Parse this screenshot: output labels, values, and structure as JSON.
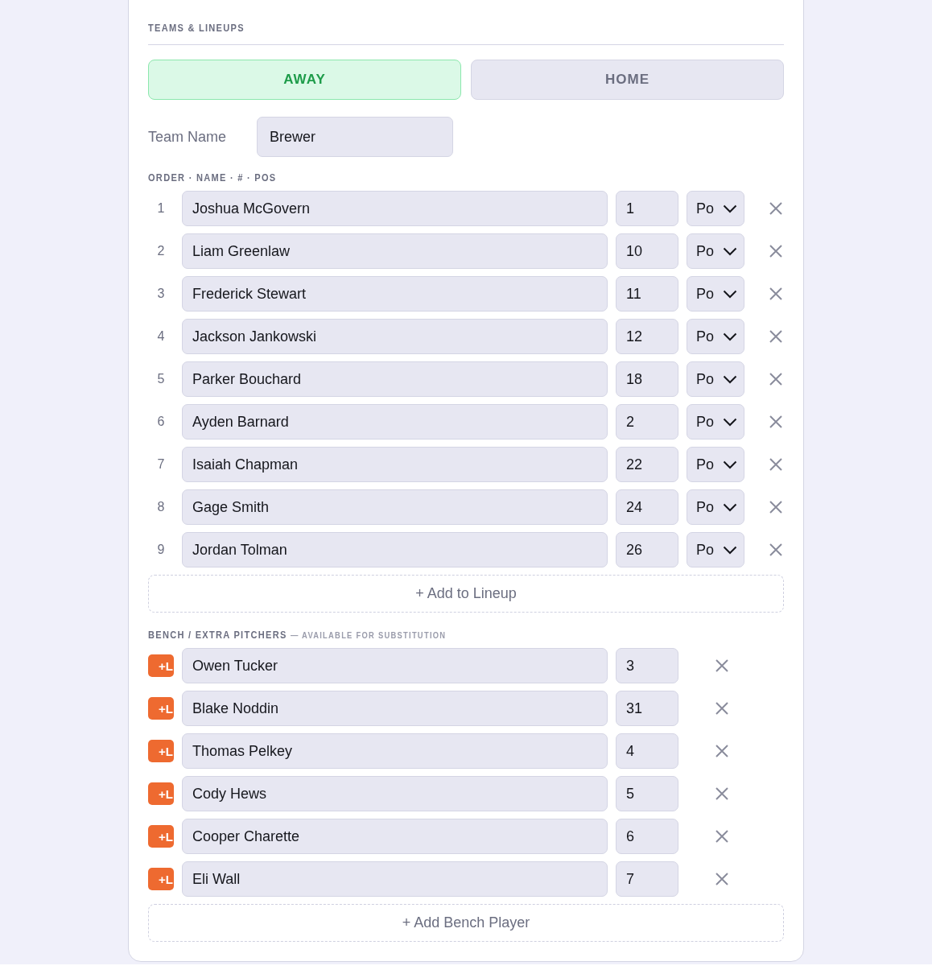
{
  "section_title": "TEAMS & LINEUPS",
  "tabs": [
    {
      "label": "AWAY",
      "selected": true
    },
    {
      "label": "HOME",
      "selected": false
    }
  ],
  "team_name": {
    "label": "Team Name",
    "value": "Brewer"
  },
  "lineup": {
    "heading": "ORDER · NAME · # · POS",
    "rows": [
      {
        "order": "1",
        "name": "Joshua McGovern",
        "number": "1",
        "position": "Po"
      },
      {
        "order": "2",
        "name": "Liam Greenlaw",
        "number": "10",
        "position": "Po"
      },
      {
        "order": "3",
        "name": "Frederick Stewart",
        "number": "11",
        "position": "Po"
      },
      {
        "order": "4",
        "name": "Jackson Jankowski",
        "number": "12",
        "position": "Po"
      },
      {
        "order": "5",
        "name": "Parker Bouchard",
        "number": "18",
        "position": "Po"
      },
      {
        "order": "6",
        "name": "Ayden Barnard",
        "number": "2",
        "position": "Po"
      },
      {
        "order": "7",
        "name": "Isaiah Chapman",
        "number": "22",
        "position": "Po"
      },
      {
        "order": "8",
        "name": "Gage Smith",
        "number": "24",
        "position": "Po"
      },
      {
        "order": "9",
        "name": "Jordan Tolman",
        "number": "26",
        "position": "Po"
      }
    ],
    "add_button": "+ Add to Lineup"
  },
  "bench": {
    "heading": "BENCH / EXTRA PITCHERS",
    "subheading": "— AVAILABLE FOR SUBSTITUTION",
    "rows": [
      {
        "badge": "+L",
        "name": "Owen Tucker",
        "number": "3"
      },
      {
        "badge": "+L",
        "name": "Blake Noddin",
        "number": "31"
      },
      {
        "badge": "+L",
        "name": "Thomas Pelkey",
        "number": "4"
      },
      {
        "badge": "+L",
        "name": "Cody Hews",
        "number": "5"
      },
      {
        "badge": "+L",
        "name": "Cooper Charette",
        "number": "6"
      },
      {
        "badge": "+L",
        "name": "Eli Wall",
        "number": "7"
      }
    ],
    "add_button": "+ Add Bench Player"
  }
}
